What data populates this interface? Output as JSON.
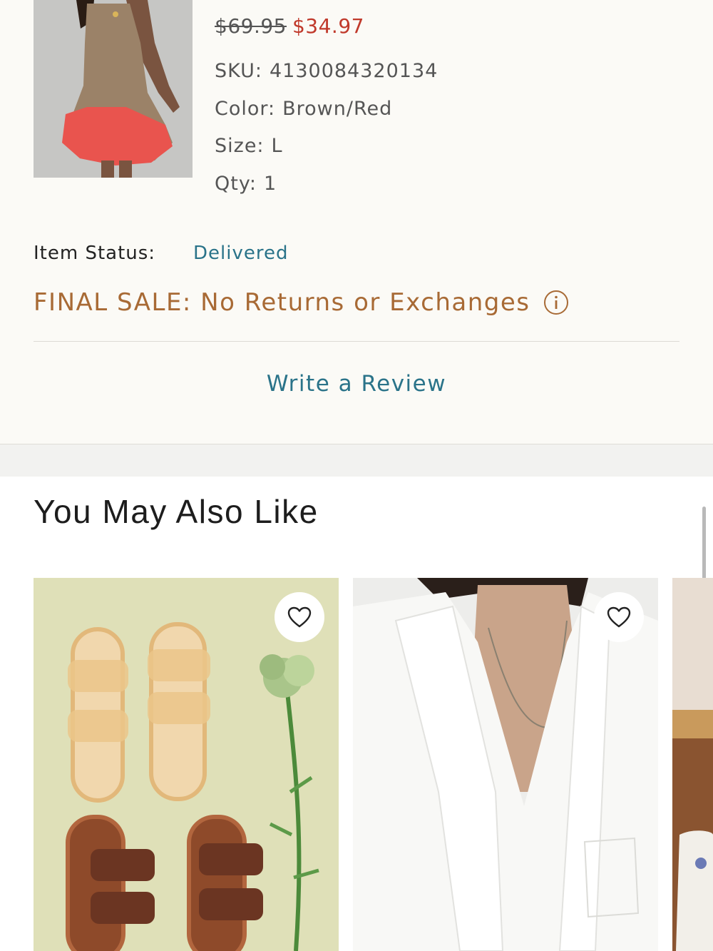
{
  "order_item": {
    "price_original": "$69.95",
    "price_sale": "$34.97",
    "sku_label": "SKU:",
    "sku_value": "4130084320134",
    "color_label": "Color:",
    "color_value": "Brown/Red",
    "size_label": "Size:",
    "size_value": "L",
    "qty_label": "Qty:",
    "qty_value": "1",
    "status_label": "Item Status:",
    "status_value": "Delivered",
    "final_sale": "FINAL SALE: No Returns or Exchanges",
    "write_review": "Write a Review"
  },
  "recommendations": {
    "title": "You May Also Like"
  },
  "icons": {
    "info": "info-circle-icon",
    "heart": "heart-outline-icon"
  },
  "colors": {
    "sale_red": "#c0392b",
    "link_teal": "#2a7389",
    "final_sale_brown": "#a86a35",
    "background": "#fbfaf6"
  }
}
